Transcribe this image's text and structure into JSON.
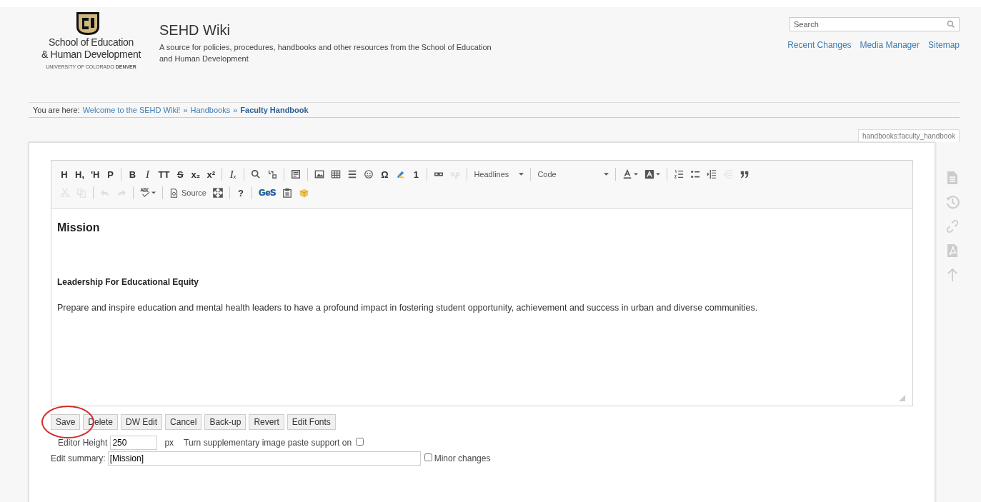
{
  "logo": {
    "line1": "School of Education",
    "line2": "& Human Development",
    "tagline": "UNIVERSITY OF COLORADO **DENVER**"
  },
  "site": {
    "title": "SEHD Wiki",
    "description": "A source for policies, procedures, handbooks and other resources from the School of Education and Human Development"
  },
  "search": {
    "placeholder": "Search"
  },
  "nav_links": [
    "Recent Changes",
    "Media Manager",
    "Sitemap"
  ],
  "breadcrumb": {
    "label": "You are here:",
    "items": [
      {
        "text": "Welcome to the SEHD Wiki!",
        "current": false
      },
      {
        "text": "Handbooks",
        "current": false
      },
      {
        "text": "Faculty Handbook",
        "current": true
      }
    ],
    "separator": "»"
  },
  "page_id": "handbooks:faculty_handbook",
  "toolbar": {
    "rows": [
      [
        [
          {
            "kind": "glyph",
            "label": "H",
            "disabled": false
          },
          {
            "kind": "glyph",
            "label": "H,",
            "disabled": false
          },
          {
            "kind": "glyph",
            "label": "'H",
            "disabled": false
          },
          {
            "kind": "glyph",
            "label": "P",
            "disabled": false
          }
        ],
        [
          {
            "kind": "glyph",
            "label": "B",
            "disabled": false
          },
          {
            "kind": "italic",
            "label": "I",
            "disabled": false
          },
          {
            "kind": "glyph",
            "label": "TT",
            "disabled": false
          },
          {
            "kind": "strike",
            "label": "S",
            "disabled": false
          },
          {
            "kind": "glyph",
            "label": "x₂",
            "disabled": false
          },
          {
            "kind": "glyph",
            "label": "x²",
            "disabled": false
          }
        ],
        [
          {
            "kind": "italic",
            "label": "Iₓ",
            "disabled": false
          }
        ],
        [
          {
            "kind": "search",
            "disabled": false
          },
          {
            "kind": "replace",
            "disabled": false
          }
        ],
        [
          {
            "kind": "template",
            "disabled": false
          }
        ],
        [
          {
            "kind": "image",
            "disabled": false
          },
          {
            "kind": "table",
            "disabled": false
          },
          {
            "kind": "rule",
            "disabled": false
          },
          {
            "kind": "smiley",
            "disabled": false
          },
          {
            "kind": "glyph",
            "label": "Ω",
            "disabled": false
          },
          {
            "kind": "highlight",
            "disabled": false
          },
          {
            "kind": "glyph",
            "label": "1",
            "disabled": false
          }
        ],
        [
          {
            "kind": "link",
            "disabled": false
          },
          {
            "kind": "unlink",
            "disabled": true
          }
        ],
        [
          {
            "kind": "dropdown",
            "label": "Headlines",
            "disabled": false
          }
        ],
        [
          {
            "kind": "dropdown",
            "label": "Code",
            "disabled": false
          }
        ],
        [
          {
            "kind": "text-color",
            "disabled": false
          },
          {
            "kind": "bg-color",
            "disabled": false
          }
        ],
        [
          {
            "kind": "ol",
            "disabled": false
          },
          {
            "kind": "ul",
            "disabled": false
          },
          {
            "kind": "indent",
            "disabled": false
          },
          {
            "kind": "outdent",
            "disabled": true
          },
          {
            "kind": "quote",
            "disabled": false
          }
        ]
      ],
      [
        [
          {
            "kind": "cut",
            "disabled": true
          },
          {
            "kind": "copy",
            "disabled": true
          }
        ],
        [
          {
            "kind": "undo",
            "disabled": true
          },
          {
            "kind": "redo",
            "disabled": true
          }
        ],
        [
          {
            "kind": "spell",
            "disabled": false
          }
        ],
        [
          {
            "kind": "source",
            "label": "Source",
            "disabled": false
          },
          {
            "kind": "maximize",
            "disabled": false
          }
        ],
        [
          {
            "kind": "glyph",
            "label": "?",
            "disabled": false
          }
        ],
        [
          {
            "kind": "ges",
            "label": "GeS",
            "disabled": false
          },
          {
            "kind": "paste",
            "disabled": false
          },
          {
            "kind": "package",
            "disabled": false
          }
        ]
      ]
    ]
  },
  "content": [
    {
      "kind": "heading",
      "text": "Mission"
    },
    {
      "kind": "subheading",
      "text": "Leadership For Educational Equity"
    },
    {
      "kind": "paragraph",
      "text": "Prepare and inspire education and mental health leaders to have a profound impact in fostering student opportunity, achievement and success in urban and diverse communities."
    }
  ],
  "buttons": [
    {
      "label": "Save",
      "circled": true
    },
    {
      "label": "Delete",
      "circled": false
    },
    {
      "label": "DW Edit",
      "circled": false
    },
    {
      "label": "Cancel",
      "circled": false
    },
    {
      "label": "Back-up",
      "circled": false
    },
    {
      "label": "Revert",
      "circled": false
    },
    {
      "label": "Edit Fonts",
      "circled": false
    }
  ],
  "editor_height": {
    "label": "Editor Height",
    "value": "250",
    "unit": "px"
  },
  "paste_support": {
    "label": "Turn supplementary image paste support on",
    "checked": false
  },
  "summary": {
    "label": "Edit summary:",
    "value": "[Mission]"
  },
  "minor_changes": {
    "label": "Minor changes",
    "checked": false
  }
}
